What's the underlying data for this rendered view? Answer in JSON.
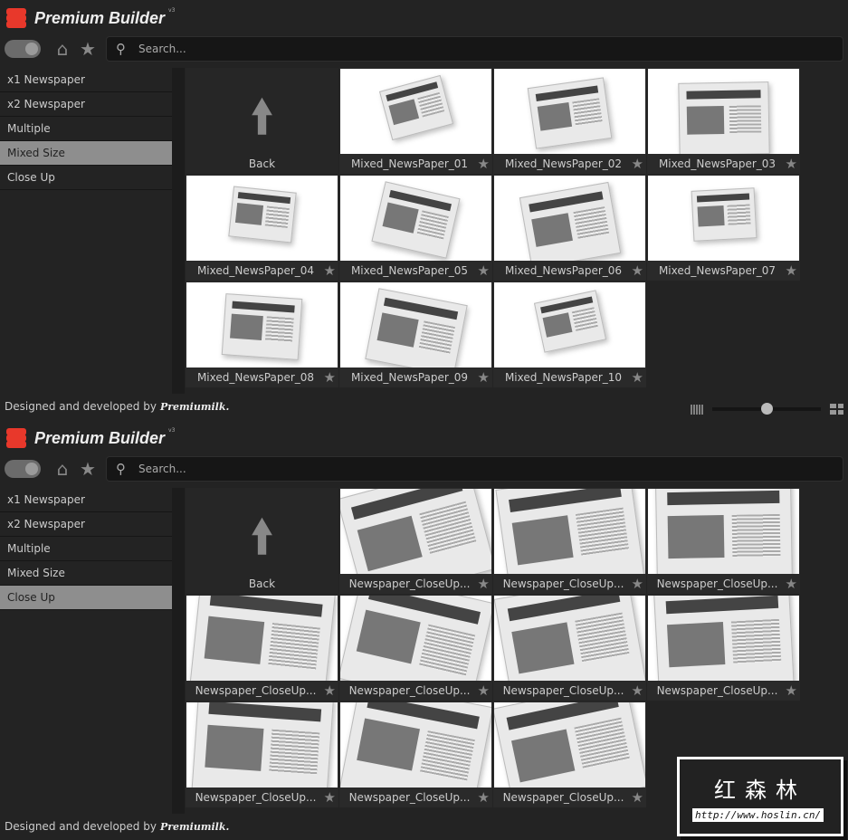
{
  "app": {
    "title": "Premium Builder",
    "version": "v3"
  },
  "toolbar": {
    "search_placeholder": "Search..."
  },
  "sidebar": {
    "items": [
      "x1 Newspaper",
      "x2 Newspaper",
      "Multiple",
      "Mixed Size",
      "Close Up"
    ]
  },
  "panels": [
    {
      "active": 3,
      "back_label": "Back",
      "tiles": [
        "Mixed_NewsPaper_01",
        "Mixed_NewsPaper_02",
        "Mixed_NewsPaper_03",
        "Mixed_NewsPaper_04",
        "Mixed_NewsPaper_05",
        "Mixed_NewsPaper_06",
        "Mixed_NewsPaper_07",
        "Mixed_NewsPaper_08",
        "Mixed_NewsPaper_09",
        "Mixed_NewsPaper_10"
      ],
      "zoom_fraction": 0.5
    },
    {
      "active": 4,
      "back_label": "Back",
      "tiles": [
        "Newspaper_CloseUp...",
        "Newspaper_CloseUp...",
        "Newspaper_CloseUp...",
        "Newspaper_CloseUp...",
        "Newspaper_CloseUp...",
        "Newspaper_CloseUp...",
        "Newspaper_CloseUp...",
        "Newspaper_CloseUp...",
        "Newspaper_CloseUp...",
        "Newspaper_CloseUp..."
      ],
      "zoom_fraction": 0.5
    }
  ],
  "footer": {
    "text": "Designed and developed by",
    "brand": "Premiumilk."
  },
  "watermark": {
    "title": "红森林",
    "url": "http://www.hoslin.cn/"
  },
  "colors": {
    "accent": "#e8382b",
    "active_item": "#8e8e8e"
  }
}
